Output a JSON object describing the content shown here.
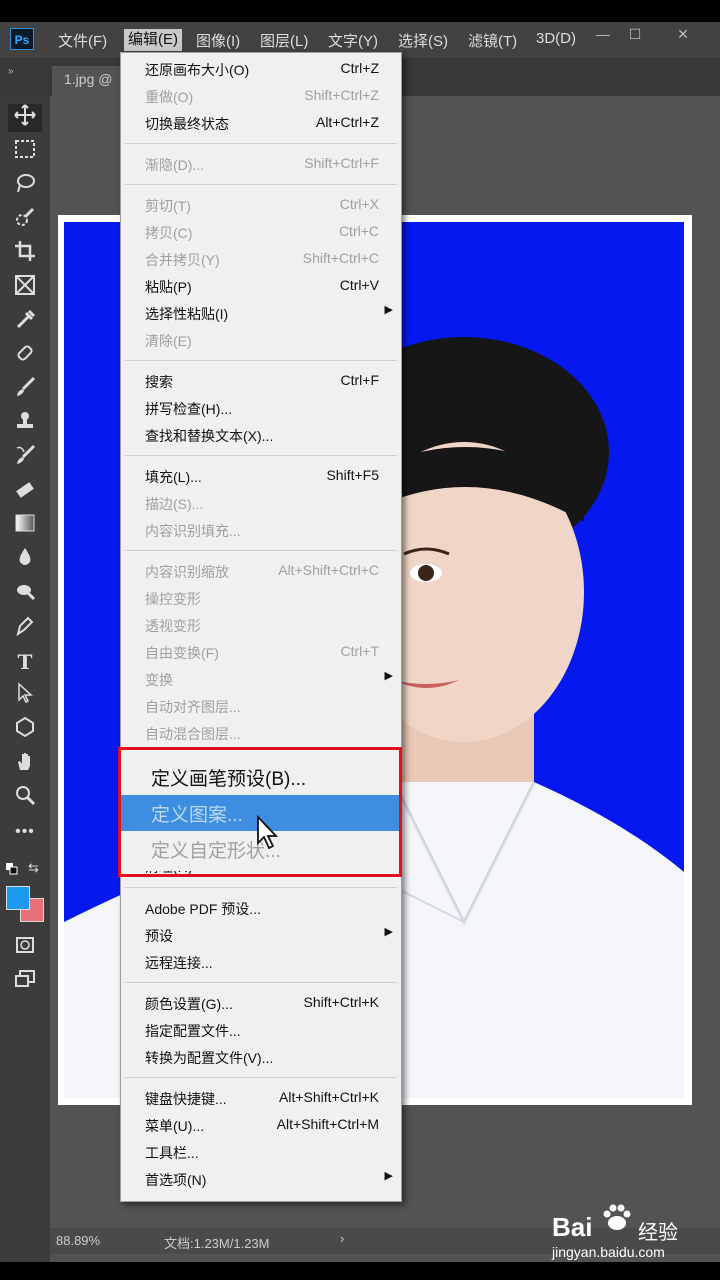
{
  "menubar": {
    "logo": "Ps",
    "items": [
      "文件(F)",
      "编辑(E)",
      "图像(I)",
      "图层(L)",
      "文字(Y)",
      "选择(S)",
      "滤镜(T)",
      "3D(D)"
    ],
    "window_controls": [
      "—",
      "☐",
      "✕"
    ]
  },
  "tab": {
    "title": "1.jpg @",
    "collapse": "»"
  },
  "toolbar": {
    "tools": [
      "move-icon",
      "marquee-icon",
      "lasso-icon",
      "quick-select-icon",
      "crop-icon",
      "frame-icon",
      "eyedropper-icon",
      "healing-icon",
      "brush-icon",
      "stamp-icon",
      "history-brush-icon",
      "eraser-icon",
      "gradient-icon",
      "blur-icon",
      "dodge-icon",
      "pen-icon",
      "type-icon",
      "path-select-icon",
      "shape-icon",
      "hand-icon",
      "zoom-icon",
      "more-icon"
    ],
    "colors": {
      "foreground": "#1b9af0",
      "background": "#e8707a"
    }
  },
  "status": {
    "zoom": "88.89%",
    "doc": "文档:1.23M/1.23M",
    "arrow": "›"
  },
  "edit_menu": {
    "groups": [
      [
        {
          "label": "还原画布大小(O)",
          "shortcut": "Ctrl+Z",
          "enabled": true
        },
        {
          "label": "重做(O)",
          "shortcut": "Shift+Ctrl+Z",
          "enabled": false
        },
        {
          "label": "切换最终状态",
          "shortcut": "Alt+Ctrl+Z",
          "enabled": true
        }
      ],
      [
        {
          "label": "渐隐(D)...",
          "shortcut": "Shift+Ctrl+F",
          "enabled": false
        }
      ],
      [
        {
          "label": "剪切(T)",
          "shortcut": "Ctrl+X",
          "enabled": false
        },
        {
          "label": "拷贝(C)",
          "shortcut": "Ctrl+C",
          "enabled": false
        },
        {
          "label": "合并拷贝(Y)",
          "shortcut": "Shift+Ctrl+C",
          "enabled": false
        },
        {
          "label": "粘贴(P)",
          "shortcut": "Ctrl+V",
          "enabled": true
        },
        {
          "label": "选择性粘贴(I)",
          "shortcut": "",
          "enabled": true,
          "submenu": true
        },
        {
          "label": "清除(E)",
          "shortcut": "",
          "enabled": false
        }
      ],
      [
        {
          "label": "搜索",
          "shortcut": "Ctrl+F",
          "enabled": true
        },
        {
          "label": "拼写检查(H)...",
          "shortcut": "",
          "enabled": true
        },
        {
          "label": "查找和替换文本(X)...",
          "shortcut": "",
          "enabled": true
        }
      ],
      [
        {
          "label": "填充(L)...",
          "shortcut": "Shift+F5",
          "enabled": true
        },
        {
          "label": "描边(S)...",
          "shortcut": "",
          "enabled": false
        },
        {
          "label": "内容识别填充...",
          "shortcut": "",
          "enabled": false
        }
      ],
      [
        {
          "label": "内容识别缩放",
          "shortcut": "Alt+Shift+Ctrl+C",
          "enabled": false
        },
        {
          "label": "操控变形",
          "shortcut": "",
          "enabled": false
        },
        {
          "label": "透视变形",
          "shortcut": "",
          "enabled": false
        },
        {
          "label": "自由变换(F)",
          "shortcut": "Ctrl+T",
          "enabled": false
        },
        {
          "label": "变换",
          "shortcut": "",
          "enabled": false,
          "submenu": true
        },
        {
          "label": "自动对齐图层...",
          "shortcut": "",
          "enabled": false
        },
        {
          "label": "自动混合图层...",
          "shortcut": "",
          "enabled": false
        }
      ]
    ],
    "define_group": [
      {
        "label": "定义画笔预设(B)...",
        "enabled": true,
        "highlighted": false
      },
      {
        "label": "定义图案...",
        "enabled": false,
        "highlighted": true
      },
      {
        "label": "定义自定形状...",
        "enabled": false,
        "highlighted": false
      }
    ],
    "hidden_partial": "清理(R)",
    "lower_groups": [
      [
        {
          "label": "Adobe PDF 预设...",
          "shortcut": "",
          "enabled": true
        },
        {
          "label": "预设",
          "shortcut": "",
          "enabled": true,
          "submenu": true
        },
        {
          "label": "远程连接...",
          "shortcut": "",
          "enabled": true
        }
      ],
      [
        {
          "label": "颜色设置(G)...",
          "shortcut": "Shift+Ctrl+K",
          "enabled": true
        },
        {
          "label": "指定配置文件...",
          "shortcut": "",
          "enabled": true
        },
        {
          "label": "转换为配置文件(V)...",
          "shortcut": "",
          "enabled": true
        }
      ],
      [
        {
          "label": "键盘快捷键...",
          "shortcut": "Alt+Shift+Ctrl+K",
          "enabled": true
        },
        {
          "label": "菜单(U)...",
          "shortcut": "Alt+Shift+Ctrl+M",
          "enabled": true
        },
        {
          "label": "工具栏...",
          "shortcut": "",
          "enabled": true
        },
        {
          "label": "首选项(N)",
          "shortcut": "",
          "enabled": true,
          "submenu": true
        }
      ]
    ]
  },
  "watermark": {
    "brand": "Bai",
    "brand_cn": "经验",
    "url": "jingyan.baidu.com"
  }
}
